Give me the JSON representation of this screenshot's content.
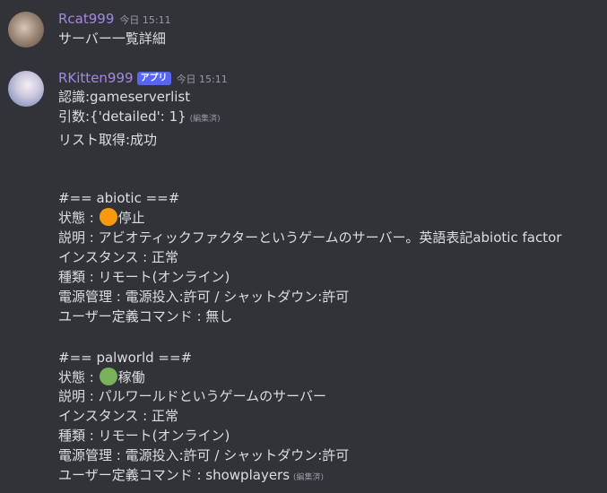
{
  "messages": [
    {
      "username": "Rcat999",
      "timestamp": "今日 15:11",
      "text": "サーバー一覧詳細"
    },
    {
      "username": "RKitten999",
      "badge": "アプリ",
      "timestamp": "今日 15:11",
      "lines": {
        "recognition": "認識:gameserverlist",
        "args": "引数:{'detailed': 1}",
        "args_edited": "(編集済)",
        "result": "リスト取得:成功"
      },
      "servers": [
        {
          "header": "#== abiotic ==#",
          "status_prefix": "状態 : ",
          "status_icon": "orange-circle",
          "status_color": "#f99a0e",
          "status": "停止",
          "description": "説明 : アビオティックファクターというゲームのサーバー。英語表記abiotic factor",
          "instance": "インスタンス : 正常",
          "type": "種類 : リモート(オンライン)",
          "power": "電源管理 : 電源投入:許可 / シャットダウン:許可",
          "commands": "ユーザー定義コマンド : 無し"
        },
        {
          "header": "#== palworld ==#",
          "status_prefix": "状態 : ",
          "status_icon": "green-circle",
          "status_color": "#78b159",
          "status": "稼働",
          "description": "説明 : パルワールドというゲームのサーバー",
          "instance": "インスタンス : 正常",
          "type": "種類 : リモート(オンライン)",
          "power": "電源管理 : 電源投入:許可 / シャットダウン:許可",
          "commands": "ユーザー定義コマンド : showplayers",
          "commands_edited": "(編集済)"
        }
      ]
    }
  ]
}
